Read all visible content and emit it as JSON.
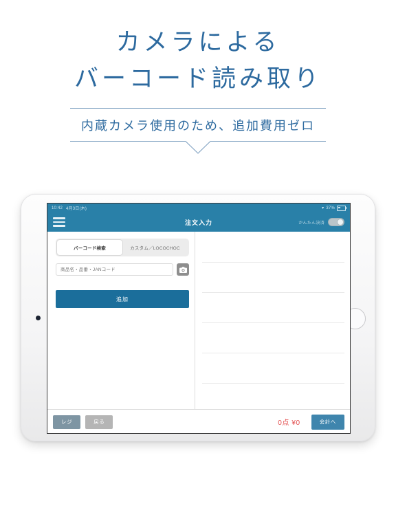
{
  "hero": {
    "headline_lines": [
      "カメラによる",
      "バーコード読み取り"
    ],
    "subhead": "内蔵カメラ使用のため、追加費用ゼロ",
    "accent_color": "#2d6a9f",
    "rule_color": "#7d9fc0"
  },
  "device": {
    "kind": "tablet",
    "camera_icon": "front-camera-dot",
    "home_icon": "home-button"
  },
  "statusbar": {
    "time": "10:42",
    "date": "4月3日(木)",
    "wifi_icon": "wifi-icon",
    "battery_text": "37%",
    "battery_icon": "battery-icon"
  },
  "navbar": {
    "menu_icon": "hamburger-menu-icon",
    "title": "注文入力",
    "toggle_label": "かんたん決済",
    "toggle_state": "off",
    "background": "#2980a8"
  },
  "left_pane": {
    "tabs": [
      {
        "label": "バーコード検索",
        "active": true
      },
      {
        "label": "カスタム／LOCOCHOC",
        "active": false
      }
    ],
    "search": {
      "value": "",
      "placeholder": "商品名・品番・JANコード",
      "camera_icon": "camera-icon"
    },
    "add_button": "追加",
    "add_button_color": "#1b6e9b"
  },
  "right_pane": {
    "rows": [
      "",
      "",
      "",
      "",
      ""
    ]
  },
  "toolbar": {
    "register_label": "レジ",
    "back_label": "戻る",
    "total_text": "0点 ¥0",
    "total_color": "#e24b4b",
    "checkout_label": "会計へ",
    "checkout_color": "#3f85ad"
  }
}
